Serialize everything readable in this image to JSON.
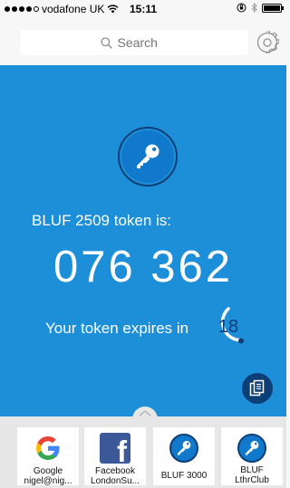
{
  "status": {
    "carrier": "vodafone UK",
    "time": "15:11"
  },
  "search": {
    "placeholder": "Search"
  },
  "token": {
    "label": "BLUF 2509 token is:",
    "code": "076 362",
    "expires_text": "Your token expires in",
    "seconds": "18"
  },
  "accounts": [
    {
      "label_line1": "Google",
      "label_line2": "nigel@nig...",
      "icon": "google-icon"
    },
    {
      "label_line1": "Facebook",
      "label_line2": "LondonSu...",
      "icon": "facebook-icon"
    },
    {
      "label_line1": "BLUF 3000",
      "label_line2": "",
      "icon": "key-icon"
    },
    {
      "label_line1": "BLUF",
      "label_line2": "LthrClub",
      "icon": "key-icon"
    }
  ],
  "colors": {
    "main_bg": "#1d8ed8",
    "dark_blue": "#0c3e78",
    "tray_bg": "#e7e7e7"
  }
}
